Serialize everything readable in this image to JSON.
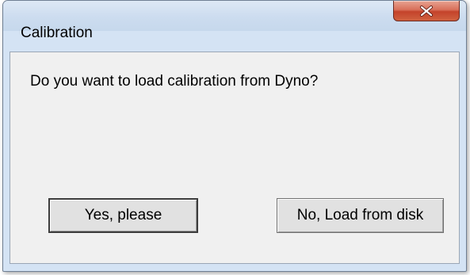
{
  "window": {
    "title": "Calibration",
    "close_icon": "close-icon"
  },
  "dialog": {
    "message": "Do you want to load calibration from Dyno?",
    "yes_label": "Yes, please",
    "no_label": "No, Load from disk"
  }
}
